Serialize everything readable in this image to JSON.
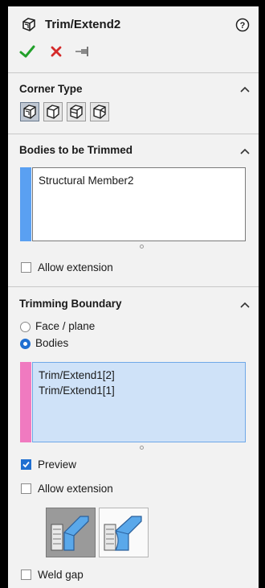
{
  "header": {
    "title": "Trim/Extend2",
    "help_icon": "help-icon",
    "ok_icon": "checkmark-icon",
    "cancel_icon": "close-icon",
    "pin_icon": "pushpin-icon"
  },
  "colors": {
    "ok": "#22a02a",
    "cancel": "#d42a2a",
    "accent": "#1f6fd1",
    "bodies_bar": "#5aa0f2",
    "boundary_bar": "#f07ac0",
    "selection_bg": "#cfe2f8"
  },
  "corner_type": {
    "title": "Corner Type",
    "buttons": [
      "end-trim-icon",
      "end-miter-icon",
      "end-butt1-icon",
      "end-butt2-icon"
    ],
    "selected_index": 0
  },
  "bodies_to_trim": {
    "title": "Bodies to be Trimmed",
    "items": [
      "Structural Member2"
    ],
    "allow_extension_label": "Allow extension",
    "allow_extension_checked": false
  },
  "trimming_boundary": {
    "title": "Trimming Boundary",
    "options": [
      "Face / plane",
      "Bodies"
    ],
    "selected_option": "Bodies",
    "items": [
      "Trim/Extend1[2]",
      "Trim/Extend1[1]"
    ],
    "preview_label": "Preview",
    "preview_checked": true,
    "allow_extension_label": "Allow extension",
    "allow_extension_checked": false,
    "trim_buttons": [
      "simple-cut-icon",
      "coped-cut-icon"
    ],
    "selected_trim_button": 0,
    "weld_gap_label": "Weld gap",
    "weld_gap_checked": false
  }
}
